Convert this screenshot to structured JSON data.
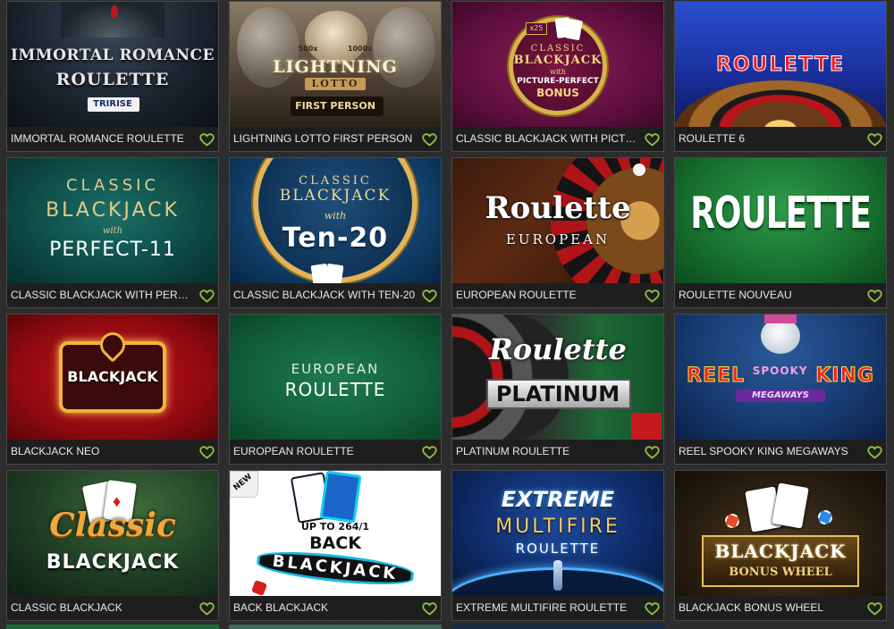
{
  "games": [
    {
      "title": "IMMORTAL ROMANCE ROULETTE",
      "logo": [
        "IMMORTAL ROMANCE",
        "ROULETTE",
        "TRIRISE"
      ]
    },
    {
      "title": "LIGHTNING LOTTO FIRST PERSON",
      "logo": [
        "LIGHTNING",
        "LOTTO",
        "FIRST PERSON",
        "500x",
        "1000x"
      ]
    },
    {
      "title": "CLASSIC BLACKJACK WITH PICTUR...",
      "logo": [
        "x25",
        "CLASSIC",
        "BLACKJACK",
        "with",
        "PICTURE-PERFECT",
        "BONUS"
      ]
    },
    {
      "title": "ROULETTE 6",
      "logo": [
        "ROULETTE"
      ]
    },
    {
      "title": "CLASSIC BLACKJACK WITH PERFECT...",
      "logo": [
        "CLASSIC",
        "BLACKJACK",
        "with",
        "PERFECT-11"
      ]
    },
    {
      "title": "CLASSIC BLACKJACK WITH TEN-20",
      "logo": [
        "CLASSIC",
        "BLACKJACK",
        "with",
        "Ten-20"
      ]
    },
    {
      "title": "EUROPEAN ROULETTE",
      "logo": [
        "Roulette",
        "EUROPEAN"
      ]
    },
    {
      "title": "ROULETTE NOUVEAU",
      "logo": [
        "ROULETTE"
      ]
    },
    {
      "title": "BLACKJACK NEO",
      "logo": [
        "BLACKJACK"
      ]
    },
    {
      "title": "EUROPEAN ROULETTE",
      "logo": [
        "EUROPEAN",
        "ROULETTE"
      ]
    },
    {
      "title": "PLATINUM ROULETTE",
      "logo": [
        "Roulette",
        "PLATINUM"
      ]
    },
    {
      "title": "REEL SPOOKY KING MEGAWAYS",
      "logo": [
        "REEL",
        "SPOOKY",
        "KING",
        "MEGAWAYS"
      ]
    },
    {
      "title": "CLASSIC BLACKJACK",
      "logo": [
        "Classic",
        "BLACKJACK"
      ]
    },
    {
      "title": "BACK BLACKJACK",
      "logo": [
        "NEW",
        "UP TO 264/1",
        "BACK",
        "BLACKJACK"
      ]
    },
    {
      "title": "EXTREME MULTIFIRE ROULETTE",
      "logo": [
        "EXTREME",
        "MULTIFIRE",
        "ROULETTE"
      ]
    },
    {
      "title": "BLACKJACK BONUS WHEEL",
      "logo": [
        "BLACKJACK",
        "BONUS WHEEL"
      ]
    }
  ],
  "colors": {
    "favorite": "#8dc63f",
    "caption_bg": "#1e1e1e",
    "caption_text": "#e9e9e9"
  },
  "icons": {
    "favorite": "heart-outline-icon"
  }
}
